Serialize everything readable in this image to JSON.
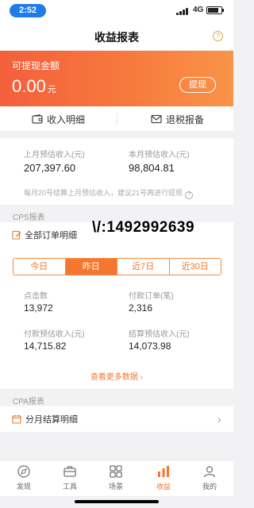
{
  "status_bar": {
    "time": "2:52",
    "network": "4G"
  },
  "header": {
    "title": "收益报表",
    "help_icon": "help-circle-icon"
  },
  "banner": {
    "label": "可提现金额",
    "amount": "0.00",
    "unit": "元",
    "withdraw_button": "提现",
    "gradient": [
      "#f45f3c",
      "#f9944a"
    ]
  },
  "actions": [
    {
      "label": "收入明细",
      "icon": "wallet-icon"
    },
    {
      "label": "退税报备",
      "icon": "mail-icon"
    }
  ],
  "estimates": {
    "last_month_label": "上月预估收入(元)",
    "last_month_value": "207,397.60",
    "this_month_label": "本月预估收入(元)",
    "this_month_value": "98,804.81",
    "note": "每月20号结算上月预估收入，建议21号再进行提现"
  },
  "cps": {
    "section_title": "CPS报表",
    "all_orders": "全部订单明细",
    "watermark": "\\/:1492992639",
    "tabs": [
      "今日",
      "昨日",
      "近7日",
      "近30日"
    ],
    "active_tab": "昨日",
    "stats": {
      "clicks_label": "点击数",
      "clicks_value": "13,972",
      "orders_label": "付款订单(笔)",
      "orders_value": "2,316",
      "pay_estimate_label": "付款预估收入(元)",
      "pay_estimate_value": "14,715.82",
      "settle_estimate_label": "结算预估收入(元)",
      "settle_estimate_value": "14,073.98"
    },
    "more_link": "查看更多数据",
    "more_chevron": "›"
  },
  "cpa": {
    "section_title": "CPA报表",
    "monthly_label": "分月结算明细",
    "chevron": "›"
  },
  "tabbar": [
    {
      "label": "发现",
      "icon": "discover-icon"
    },
    {
      "label": "工具",
      "icon": "toolbox-icon"
    },
    {
      "label": "场景",
      "icon": "grid-icon"
    },
    {
      "label": "收益",
      "icon": "income-icon"
    },
    {
      "label": "我的",
      "icon": "profile-icon"
    }
  ],
  "colors": {
    "accent": "#f5762f",
    "time_pill": "#1f7ce8"
  }
}
